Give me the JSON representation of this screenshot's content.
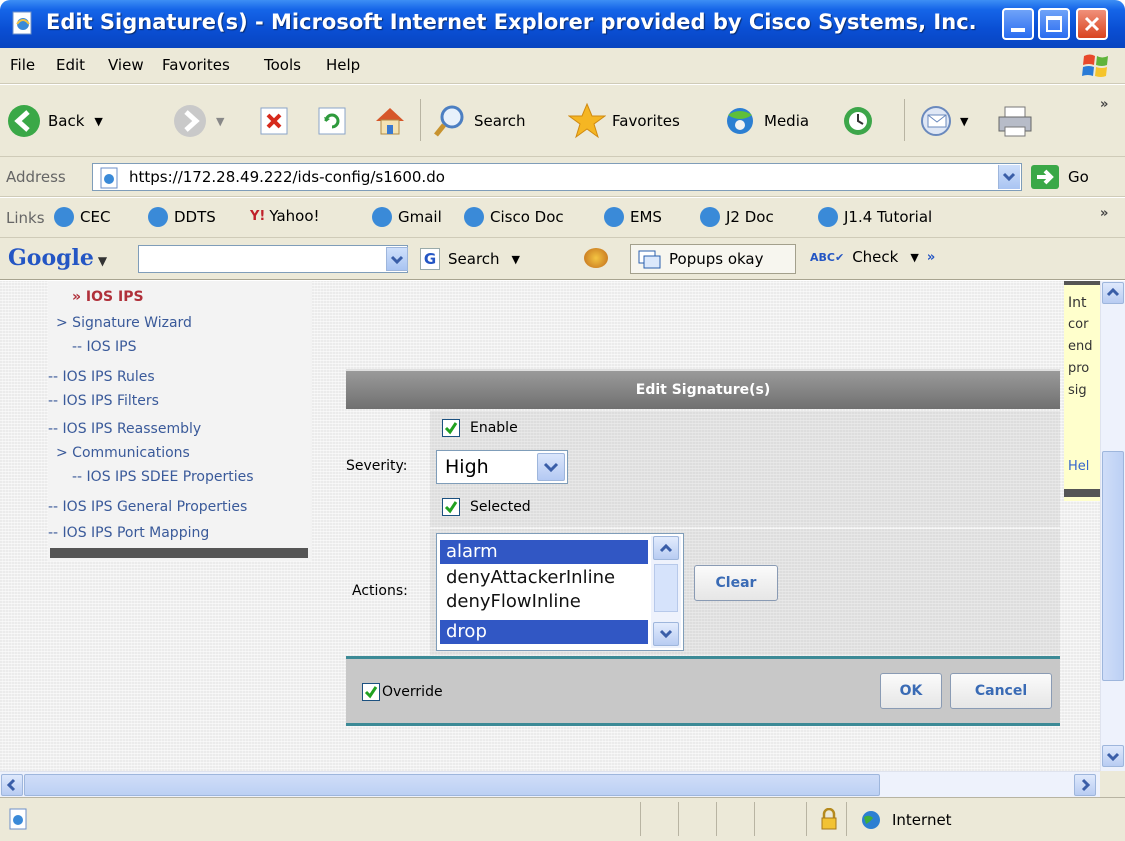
{
  "window": {
    "title": "Edit Signature(s) - Microsoft Internet Explorer provided by Cisco Systems, Inc."
  },
  "menu": [
    "File",
    "Edit",
    "View",
    "Favorites",
    "Tools",
    "Help"
  ],
  "toolbar": {
    "back": "Back",
    "search": "Search",
    "favorites": "Favorites",
    "media": "Media",
    "more": "»"
  },
  "address": {
    "label": "Address",
    "url": "https://172.28.49.222/ids-config/s1600.do",
    "go": "Go"
  },
  "links": {
    "label": "Links",
    "items": [
      "CEC",
      "DDTS",
      "Yahoo!",
      "Gmail",
      "Cisco Doc",
      "EMS",
      "J2 Doc",
      "J1.4 Tutorial"
    ],
    "more": "»"
  },
  "google": {
    "logo": "Google",
    "search": "Search",
    "popups": "Popups okay",
    "check": "Check",
    "more": "»"
  },
  "nav": {
    "items": [
      {
        "label": "» IOS IPS",
        "active": true
      },
      {
        "label": "> Signature Wizard"
      },
      {
        "label": "-- IOS IPS"
      },
      {
        "label": "-- IOS IPS Rules"
      },
      {
        "label": "-- IOS IPS Filters"
      },
      {
        "label": "-- IOS IPS Reassembly"
      },
      {
        "label": "> Communications"
      },
      {
        "label": "-- IOS IPS SDEE Properties"
      },
      {
        "label": "-- IOS IPS General Properties"
      },
      {
        "label": "-- IOS IPS Port Mapping"
      }
    ]
  },
  "help_panel": {
    "lines": [
      "Int",
      "cor",
      "end",
      "pro",
      "sig"
    ],
    "link": "Hel"
  },
  "form": {
    "header": "Edit Signature(s)",
    "enable_label": "Enable",
    "severity_label": "Severity:",
    "severity_value": "High",
    "selected_label": "Selected",
    "actions_label": "Actions:",
    "actions_options": [
      {
        "label": "alarm",
        "selected": true
      },
      {
        "label": "denyAttackerInline",
        "selected": false
      },
      {
        "label": "denyFlowInline",
        "selected": false
      },
      {
        "label": "drop",
        "selected": true
      }
    ],
    "clear_button": "Clear",
    "override_label": "Override",
    "ok_button": "OK",
    "cancel_button": "Cancel"
  },
  "status": {
    "zone": "Internet"
  },
  "colors": {
    "titlebar": "#0a4fd4",
    "chrome": "#ece9d8",
    "selection": "#3157c4",
    "button_text": "#3a6bb5"
  }
}
